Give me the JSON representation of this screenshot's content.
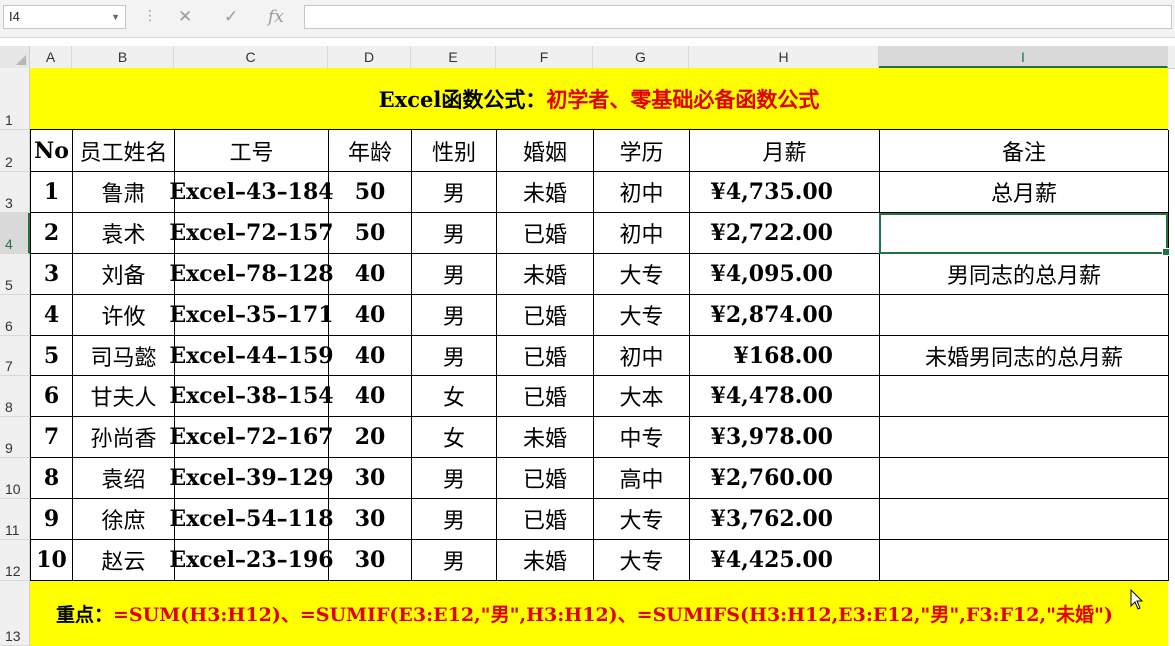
{
  "formula_bar": {
    "name_box": "I4",
    "formula": ""
  },
  "columns": [
    "A",
    "B",
    "C",
    "D",
    "E",
    "F",
    "G",
    "H",
    "I"
  ],
  "rows": [
    "1",
    "2",
    "3",
    "4",
    "5",
    "6",
    "7",
    "8",
    "9",
    "10",
    "11",
    "12",
    "13"
  ],
  "sheet": {
    "title_black": "Excel函数公式：",
    "title_red": "初学者、零基础必备函数公式",
    "headers": [
      "No",
      "员工姓名",
      "工号",
      "年龄",
      "性别",
      "婚姻",
      "学历",
      "月薪",
      "备注"
    ],
    "records": [
      [
        "1",
        "鲁肃",
        "Excel–43–184",
        "50",
        "男",
        "未婚",
        "初中",
        "¥4,735.00",
        "总月薪"
      ],
      [
        "2",
        "袁术",
        "Excel–72–157",
        "50",
        "男",
        "已婚",
        "初中",
        "¥2,722.00",
        ""
      ],
      [
        "3",
        "刘备",
        "Excel–78–128",
        "40",
        "男",
        "未婚",
        "大专",
        "¥4,095.00",
        "男同志的总月薪"
      ],
      [
        "4",
        "许攸",
        "Excel–35–171",
        "40",
        "男",
        "已婚",
        "大专",
        "¥2,874.00",
        ""
      ],
      [
        "5",
        "司马懿",
        "Excel–44–159",
        "40",
        "男",
        "已婚",
        "初中",
        "¥168.00",
        "未婚男同志的总月薪"
      ],
      [
        "6",
        "甘夫人",
        "Excel–38–154",
        "40",
        "女",
        "已婚",
        "大本",
        "¥4,478.00",
        ""
      ],
      [
        "7",
        "孙尚香",
        "Excel–72–167",
        "20",
        "女",
        "未婚",
        "中专",
        "¥3,978.00",
        ""
      ],
      [
        "8",
        "袁绍",
        "Excel–39–129",
        "30",
        "男",
        "已婚",
        "高中",
        "¥2,760.00",
        ""
      ],
      [
        "9",
        "徐庶",
        "Excel–54–118",
        "30",
        "男",
        "已婚",
        "大专",
        "¥3,762.00",
        ""
      ],
      [
        "10",
        "赵云",
        "Excel–23–196",
        "30",
        "男",
        "未婚",
        "大专",
        "¥4,425.00",
        ""
      ]
    ],
    "footer_black": "重点：",
    "footer_red": "=SUM(H3:H12)、=SUMIF(E3:E12,\"男\",H3:H12)、=SUMIFS(H3:H12,E3:E12,\"男\",F3:F12,\"未婚\")"
  },
  "colors": {
    "banner": "#ffff00",
    "accent_red": "#e00000",
    "selection": "#217346"
  },
  "icons": [
    "cancel-icon",
    "enter-icon",
    "function-icon",
    "dropdown-icon"
  ]
}
